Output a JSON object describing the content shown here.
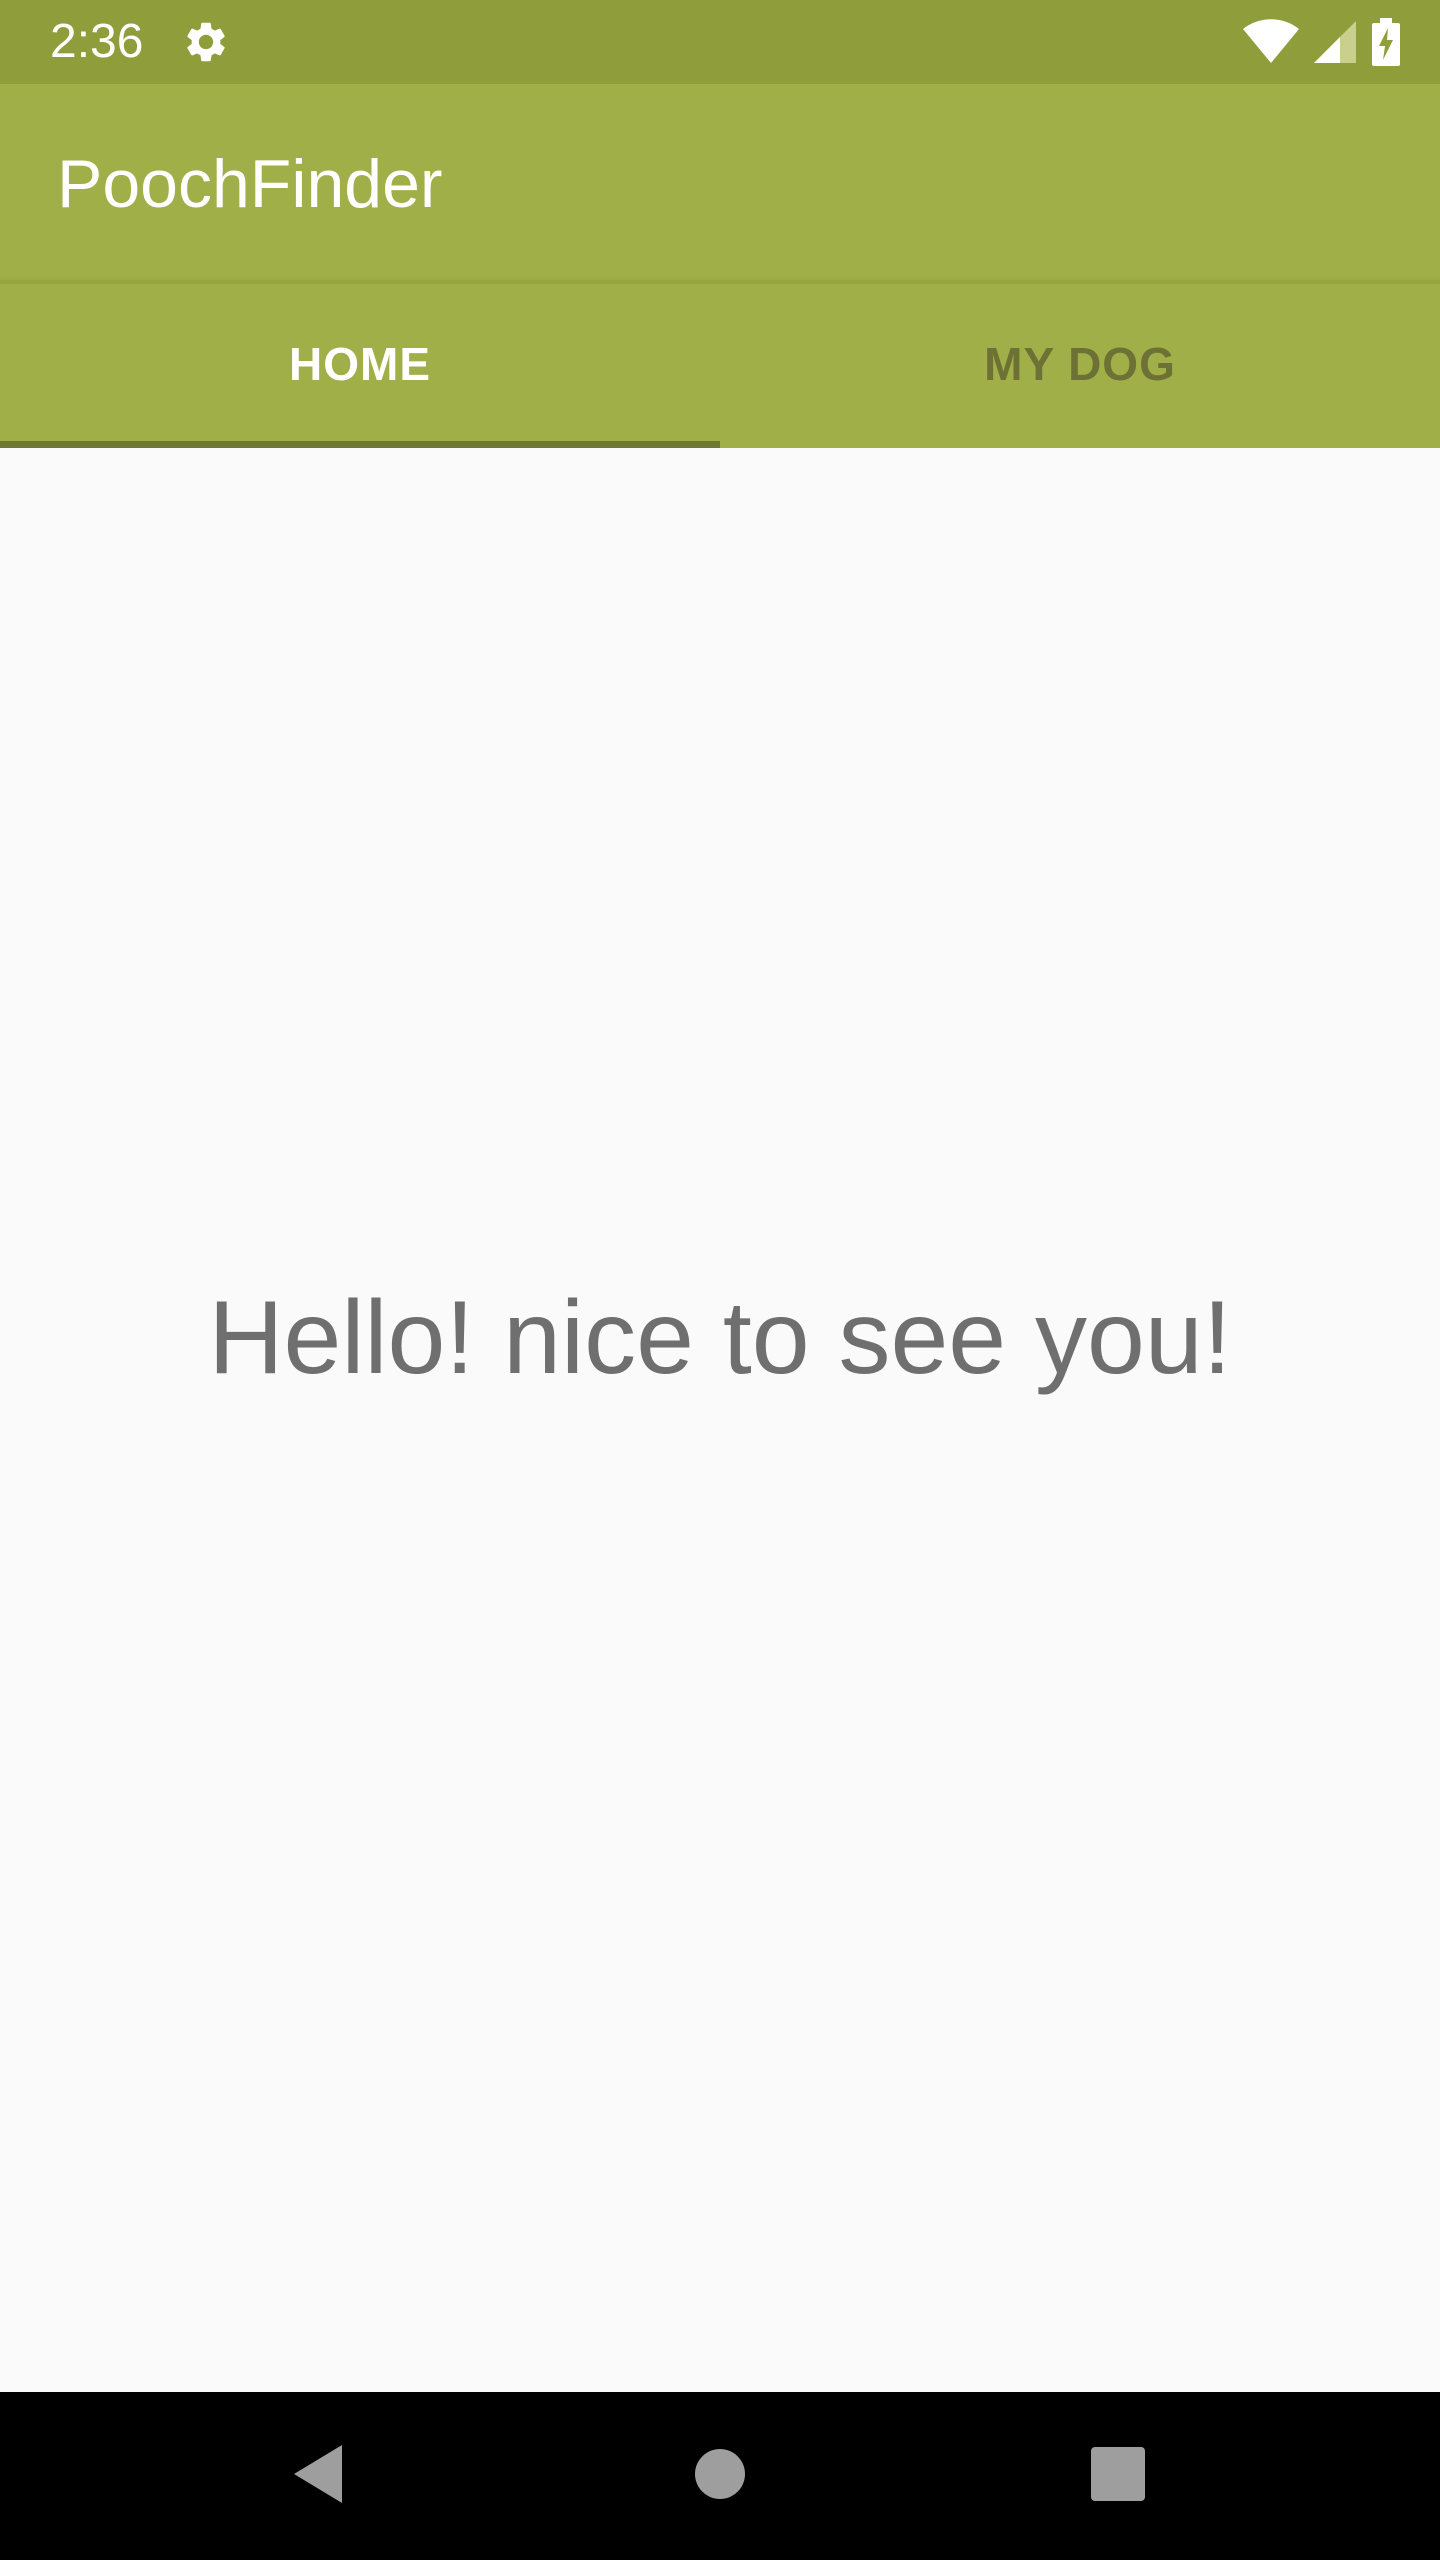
{
  "status_bar": {
    "time": "2:36",
    "icons": [
      "settings-gear-icon",
      "wifi-icon",
      "cell-signal-icon",
      "battery-charging-icon"
    ]
  },
  "app_bar": {
    "title": "PoochFinder"
  },
  "tabs": [
    {
      "label": "HOME",
      "active": true
    },
    {
      "label": "MY DOG",
      "active": false
    }
  ],
  "main": {
    "greeting": "Hello! nice to see you!"
  },
  "nav_bar": {
    "icons": [
      "back-icon",
      "home-icon",
      "recent-apps-icon"
    ]
  },
  "colors": {
    "status_bar": "#8f9e3a",
    "app_bar": "#a0af47",
    "tab_indicator": "#6f7832",
    "active_tab_text": "#ffffff",
    "inactive_tab_text": "#6e7135",
    "background": "#fafafa",
    "greeting_text": "#6f6f6f",
    "nav_bar": "#000000"
  }
}
